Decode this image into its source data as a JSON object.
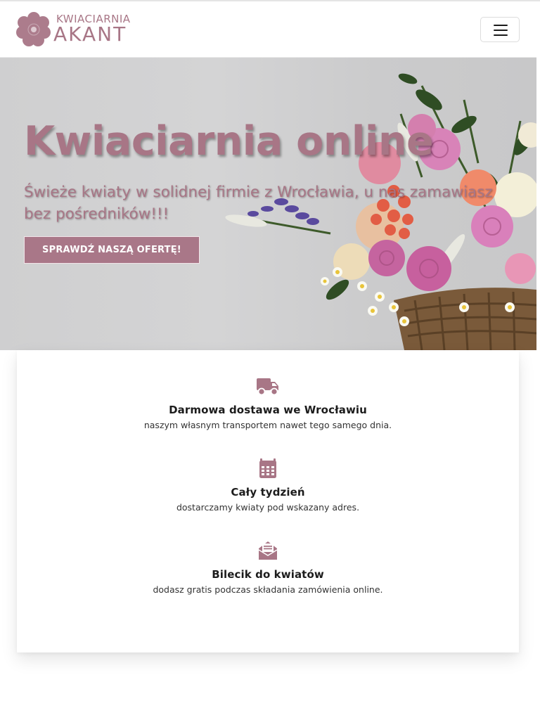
{
  "brand": {
    "small_text": "KWIACIARNIA",
    "big_text": "AKANT",
    "color": "#a87686"
  },
  "navbar": {
    "toggler_icon": "hamburger-menu-icon"
  },
  "hero": {
    "title": "Kwiaciarnia online",
    "subtitle": "Świeże kwiaty w solidnej firmie z Wrocławia, u nas zamawiasz bez pośredników!!!",
    "cta_label": "SPRAWDŹ NASZĄ OFERTĘ!",
    "accent_color": "#a87686"
  },
  "features": [
    {
      "icon": "delivery-truck-icon",
      "title": "Darmowa dostawa we Wrocławiu",
      "text": "naszym własnym transportem nawet tego samego dnia."
    },
    {
      "icon": "calendar-icon",
      "title": "Cały tydzień",
      "text": "dostarczamy kwiaty pod wskazany adres."
    },
    {
      "icon": "envelope-open-text-icon",
      "title": "Bilecik do kwiatów",
      "text": "dodasz gratis podczas składania zamówienia online."
    }
  ]
}
